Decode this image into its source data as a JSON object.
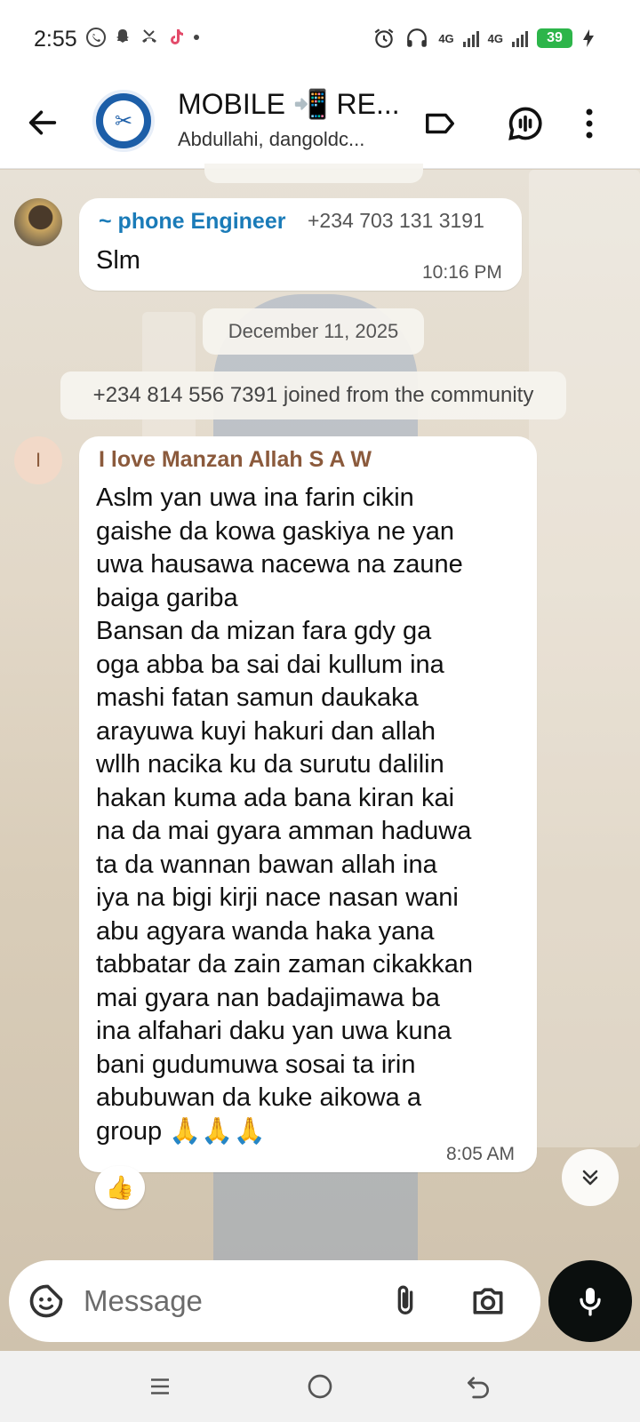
{
  "status_bar": {
    "time": "2:55",
    "left_icons": [
      "whatsapp-icon",
      "snapchat-icon",
      "missed-call-icon",
      "tiktok-icon",
      "dot-icon"
    ],
    "network_1": "4G",
    "network_2": "4G",
    "battery": "39"
  },
  "header": {
    "title": "MOBILE 📲 RE...",
    "subtitle": "Abdullahi, dangoldc...",
    "icons": [
      "back-arrow-icon",
      "label-icon",
      "voice-chat-icon",
      "more-vert-icon"
    ]
  },
  "messages": [
    {
      "sender_name": "~ phone Engineer",
      "sender_phone": "+234 703 131 3191",
      "text": "Slm",
      "time": "10:16 PM",
      "name_color": "#1a7bb8"
    },
    {
      "sender_initial": "I",
      "sender_name": "I love Manzan Allah S A W",
      "text": "Aslm yan uwa ina farin cikin\ngaishe da kowa gaskiya ne yan\nuwa hausawa nacewa na zaune\nbaiga gariba\nBansan da mizan fara gdy ga\noga abba ba sai dai kullum ina\nmashi fatan samun daukaka\narayuwa kuyi hakuri dan allah\nwllh nacika ku da surutu dalilin\nhakan kuma ada bana kiran kai\nna da mai gyara amman haduwa\nta da wannan bawan allah ina\niya na bigi kirji nace nasan wani\nabu agyara wanda haka yana\ntabbatar da zain zaman cikakkan\nmai gyara nan badajimawa ba\nina alfahari daku yan uwa kuna\nbani gudumuwa sosai ta irin\nabubuwan da kuke aikowa a\ngroup 🙏🙏🙏",
      "time": "8:05 AM",
      "name_color": "#8b5a3c",
      "reaction": "👍"
    }
  ],
  "date_separator": "December 11, 2025",
  "system_message": "+234 814 556 7391 joined from the community",
  "composer": {
    "placeholder": "Message"
  },
  "accent_colors": {
    "mic_button": "#0b0f0e",
    "battery": "#2db54a"
  }
}
